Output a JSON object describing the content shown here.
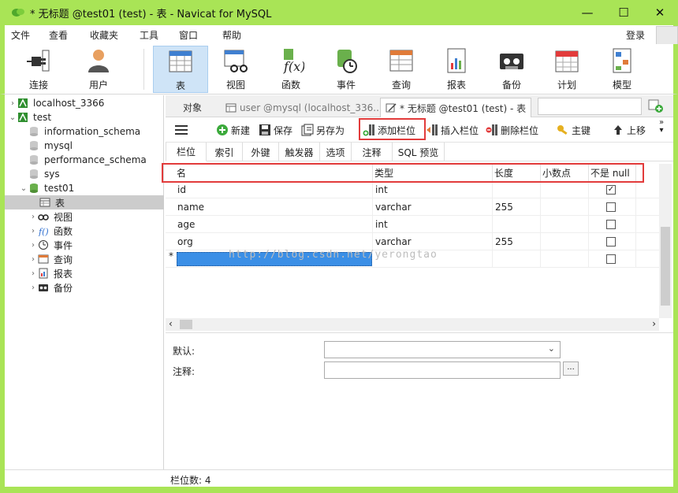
{
  "window": {
    "title": "* 无标题 @test01 (test) - 表 - Navicat for MySQL"
  },
  "menu": {
    "items": [
      "文件",
      "查看",
      "收藏夹",
      "工具",
      "窗口",
      "帮助"
    ],
    "login": "登录"
  },
  "toolbar": {
    "items": [
      {
        "label": "连接",
        "icon": "connection-icon"
      },
      {
        "label": "用户",
        "icon": "user-icon"
      },
      {
        "label": "表",
        "icon": "table-icon",
        "active": true
      },
      {
        "label": "视图",
        "icon": "view-icon"
      },
      {
        "label": "函数",
        "icon": "function-icon"
      },
      {
        "label": "事件",
        "icon": "event-icon"
      },
      {
        "label": "查询",
        "icon": "query-icon"
      },
      {
        "label": "报表",
        "icon": "report-icon"
      },
      {
        "label": "备份",
        "icon": "backup-icon"
      },
      {
        "label": "计划",
        "icon": "schedule-icon"
      },
      {
        "label": "模型",
        "icon": "model-icon"
      }
    ]
  },
  "tree": {
    "items": [
      {
        "label": "localhost_3366"
      },
      {
        "label": "test"
      },
      {
        "label": "information_schema"
      },
      {
        "label": "mysql"
      },
      {
        "label": "performance_schema"
      },
      {
        "label": "sys"
      },
      {
        "label": "test01"
      },
      {
        "label": "表"
      },
      {
        "label": "视图"
      },
      {
        "label": "函数"
      },
      {
        "label": "事件"
      },
      {
        "label": "查询"
      },
      {
        "label": "报表"
      },
      {
        "label": "备份"
      }
    ]
  },
  "tabs": [
    {
      "label": "对象"
    },
    {
      "label": "user @mysql (localhost_336..."
    },
    {
      "label": "* 无标题 @test01 (test) - 表"
    }
  ],
  "actions": {
    "new": "新建",
    "save": "保存",
    "save_as": "另存为",
    "add_field": "添加栏位",
    "insert_field": "插入栏位",
    "delete_field": "删除栏位",
    "primary_key": "主键",
    "move_up": "上移"
  },
  "subtabs": [
    "栏位",
    "索引",
    "外键",
    "触发器",
    "选项",
    "注释",
    "SQL 预览"
  ],
  "grid": {
    "headers": [
      "名",
      "类型",
      "长度",
      "小数点",
      "不是 null"
    ],
    "rows": [
      {
        "name": "id",
        "type": "int",
        "length": "",
        "decimals": "",
        "not_null": true
      },
      {
        "name": "name",
        "type": "varchar",
        "length": "255",
        "decimals": "",
        "not_null": false
      },
      {
        "name": "age",
        "type": "int",
        "length": "",
        "decimals": "",
        "not_null": false
      },
      {
        "name": "org",
        "type": "varchar",
        "length": "255",
        "decimals": "",
        "not_null": false
      }
    ],
    "new_row_marker": "*"
  },
  "watermark": "http://blog.csdn.net/yerongtao",
  "props": {
    "default_label": "默认:",
    "comment_label": "注释:",
    "dots": "..."
  },
  "status": {
    "field_count": "栏位数: 4"
  },
  "colors": {
    "accent": "#a9e456",
    "highlight": "#e23b3b",
    "selection": "#3b8fe6"
  }
}
